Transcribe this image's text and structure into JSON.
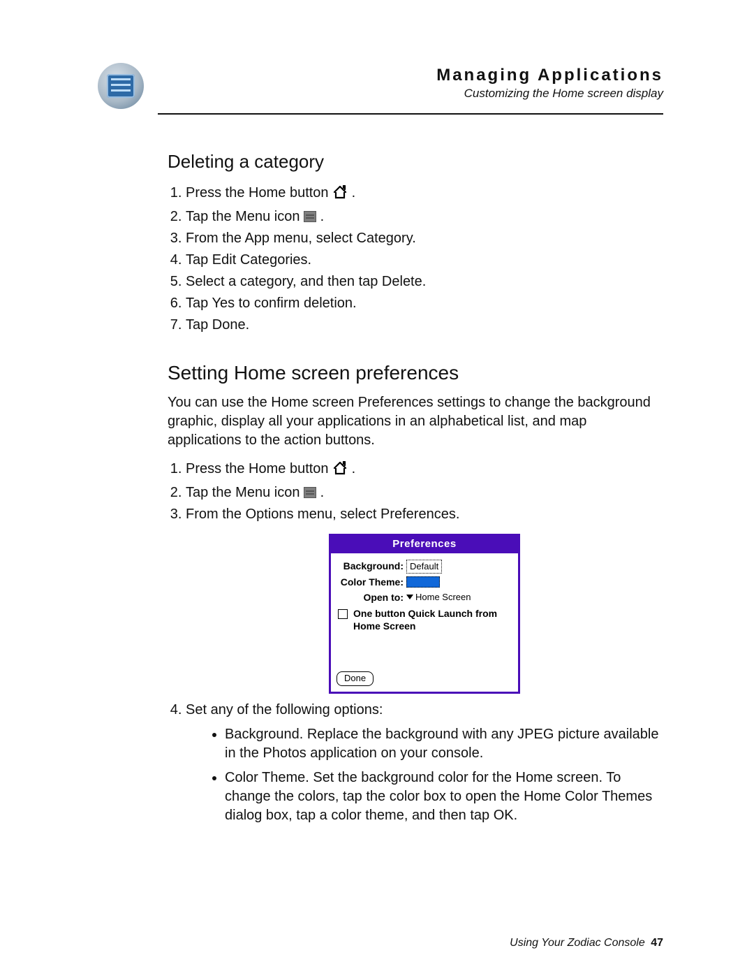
{
  "header": {
    "chapter": "Managing Applications",
    "subtitle": "Customizing the Home screen display"
  },
  "section1": {
    "title": "Deleting a category",
    "steps": [
      {
        "pre": "Press the Home button ",
        "icon": "home",
        "post": "."
      },
      {
        "pre": "Tap the Menu icon ",
        "icon": "menu",
        "post": "."
      },
      {
        "text": "From the App menu, select Category."
      },
      {
        "text": "Tap Edit Categories."
      },
      {
        "text": "Select a category, and then tap Delete."
      },
      {
        "text": "Tap Yes to confirm deletion."
      },
      {
        "text": "Tap Done."
      }
    ]
  },
  "section2": {
    "title": "Setting Home screen preferences",
    "intro": "You can use the Home screen Preferences settings to change the background graphic, display all your applications in an alphabetical list, and map applications to the action buttons.",
    "stepsA": [
      {
        "pre": "Press the Home button ",
        "icon": "home",
        "post": "."
      },
      {
        "pre": "Tap the Menu icon ",
        "icon": "menu",
        "post": "."
      },
      {
        "text": "From the Options menu, select Preferences."
      }
    ],
    "dialog": {
      "title": "Preferences",
      "bg_label": "Background:",
      "bg_value": "Default",
      "theme_label": "Color Theme:",
      "open_label": "Open to:",
      "open_value": "Home Screen",
      "check_text": "One button Quick Launch from Home Screen",
      "done": "Done"
    },
    "step4_lead": "Set any of the following options:",
    "bullets": [
      "Background. Replace the background with any JPEG picture available in the Photos application on your console.",
      "Color Theme. Set the background color for the Home screen. To change the colors, tap the color box to open the Home Color Themes dialog box, tap a color theme, and then tap OK."
    ]
  },
  "footer": {
    "text": "Using Your Zodiac Console",
    "page": "47"
  }
}
